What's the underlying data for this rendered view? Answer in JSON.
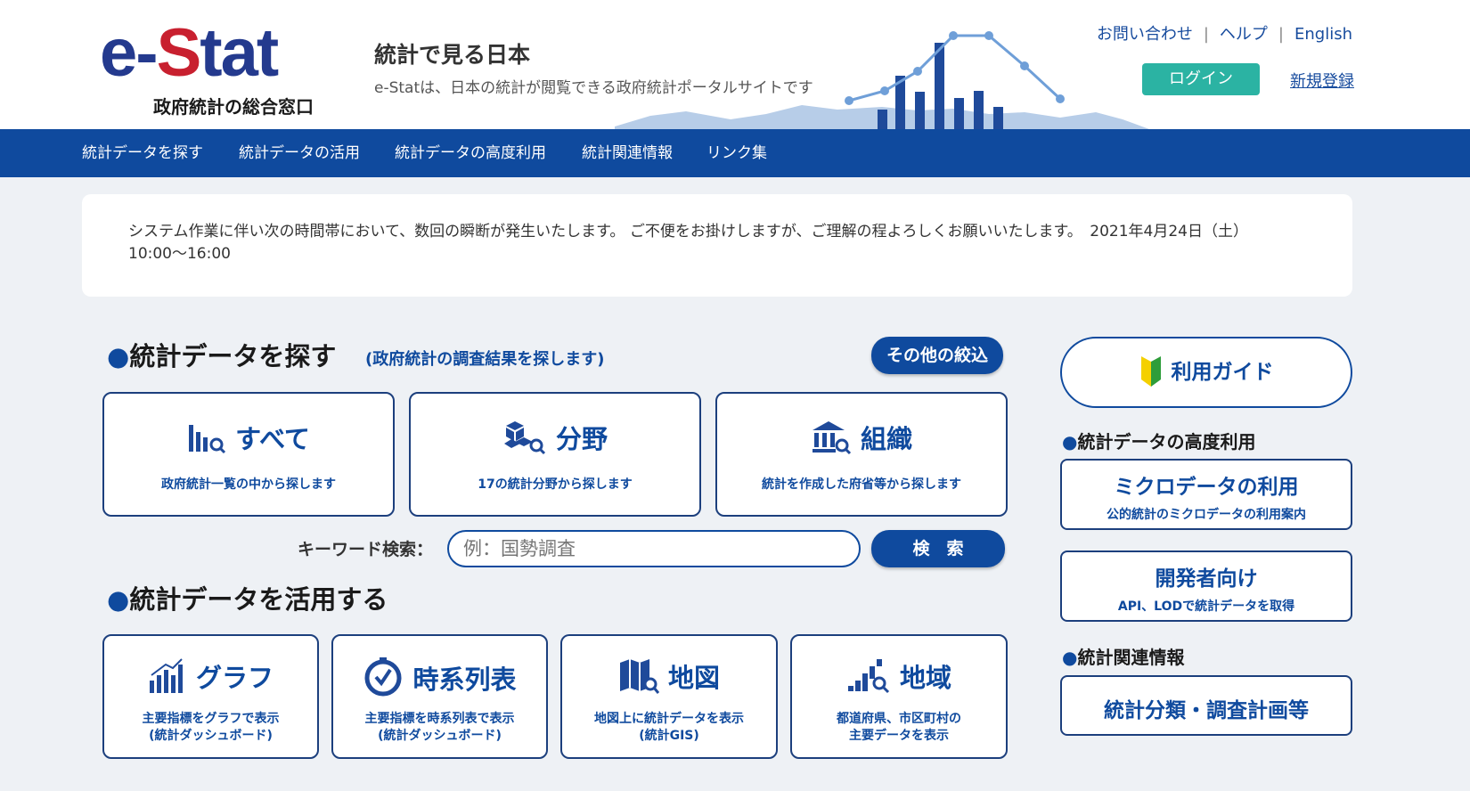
{
  "header": {
    "logo_text": "e-Stat",
    "logo_sub": "政府統計の総合窓口",
    "tagline": "統計で見る日本",
    "tagline_desc": "e-Statは、日本の統計が閲覧できる政府統計ポータルサイトです",
    "links": [
      "お問い合わせ",
      "ヘルプ",
      "English"
    ],
    "login": "ログイン",
    "register": "新規登録"
  },
  "nav": {
    "items": [
      "統計データを探す",
      "統計データの活用",
      "統計データの高度利用",
      "統計関連情報",
      "リンク集"
    ]
  },
  "notice": {
    "text": "システム作業に伴い次の時間帯において、数回の瞬断が発生いたします。 ご不便をお掛けしますが、ご理解の程よろしくお願いいたします。　2021年4月24日（土）10:00〜16:00"
  },
  "search_section": {
    "title": "統計データを探す",
    "note": "(政府統計の調査結果を探します)",
    "filter_button": "その他の絞込",
    "cards": [
      {
        "label": "すべて",
        "desc": "政府統計一覧の中から探します",
        "icon": "bar-chart-search-icon"
      },
      {
        "label": "分野",
        "desc": "17の統計分野から探します",
        "icon": "cubes-search-icon"
      },
      {
        "label": "組織",
        "desc": "統計を作成した府省等から探します",
        "icon": "building-search-icon"
      }
    ],
    "keyword_label": "キーワード検索：",
    "keyword_placeholder": "例：国勢調査",
    "search_button": "検　索"
  },
  "use_section": {
    "title": "統計データを活用する",
    "cards": [
      {
        "label": "グラフ",
        "desc": "主要指標をグラフで表示\n(統計ダッシュボード)",
        "icon": "graph-icon"
      },
      {
        "label": "時系列表",
        "desc": "主要指標を時系列表で表示\n(統計ダッシュボード)",
        "icon": "clock-icon"
      },
      {
        "label": "地図",
        "desc": "地図上に統計データを表示\n(統計GIS)",
        "icon": "map-icon"
      },
      {
        "label": "地域",
        "desc": "都道府県、市区町村の\n主要データを表示",
        "icon": "region-icon"
      }
    ]
  },
  "sidebar": {
    "guide": "利用ガイド",
    "advanced_title": "統計データの高度利用",
    "micro_title": "ミクロデータの利用",
    "micro_desc": "公的統計のミクロデータの利用案内",
    "dev_title": "開発者向け",
    "dev_desc": "API、LODで統計データを取得",
    "related_title": "統計関連情報",
    "classification": "統計分類・調査計画等"
  }
}
